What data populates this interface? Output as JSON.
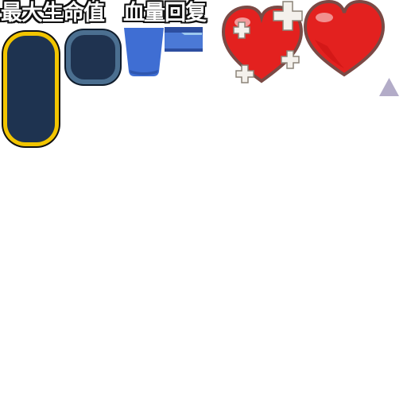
{
  "labels": {
    "max_hp": "最大生命值",
    "hp_regen": "血量回复"
  },
  "icons": {
    "heart_plus": "heart-with-plus-icon",
    "heart": "heart-icon",
    "arrow": "triangle-up-icon"
  },
  "colors": {
    "panel_fill": "#1e3350",
    "gold_border": "#f2c500",
    "steel_border": "#4b6f90",
    "water_blue": "#3f6ed3",
    "heart_red": "#e3211f",
    "heart_outline": "#7a4a45",
    "arrow": "#b3acc8"
  }
}
